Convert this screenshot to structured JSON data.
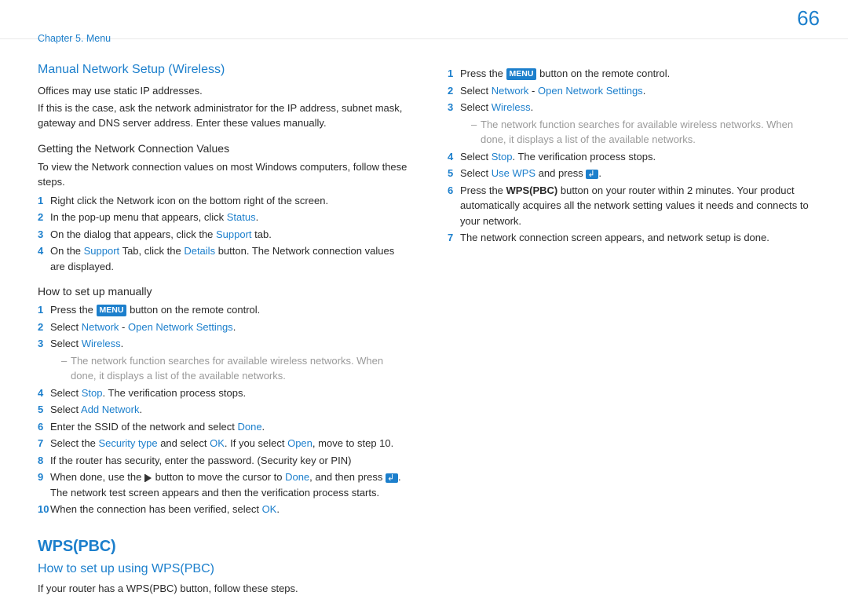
{
  "header": {
    "breadcrumb": "Chapter 5.  Menu",
    "page_number": "66"
  },
  "left": {
    "h_manual": "Manual Network Setup (Wireless)",
    "p_offices": "Offices may use static IP addresses.",
    "p_ifcase": "If this is the case, ask the network administrator for the IP address, subnet mask, gateway and DNS server address. Enter these values manually.",
    "h_getting": "Getting the Network Connection Values",
    "p_toview": "To view the Network connection values on most Windows computers, follow these steps.",
    "getting_steps": {
      "s1": "Right click the Network icon on the bottom right of the screen.",
      "s2_a": "In the pop-up menu that appears, click ",
      "s2_b": "Status",
      "s2_c": ".",
      "s3_a": "On the dialog that appears, click the ",
      "s3_b": "Support",
      "s3_c": " tab.",
      "s4_a": "On the ",
      "s4_b": "Support",
      "s4_c": " Tab, click the ",
      "s4_d": "Details",
      "s4_e": " button. The Network connection values are displayed."
    },
    "h_howto_manual": "How to set up manually",
    "manual_steps": {
      "s1_a": "Press the ",
      "s1_menu": "MENU",
      "s1_b": " button on the remote control.",
      "s2_a": "Select ",
      "s2_b": "Network",
      "s2_c": " - ",
      "s2_d": "Open Network Settings",
      "s2_e": ".",
      "s3_a": "Select ",
      "s3_b": "Wireless",
      "s3_c": ".",
      "s3_sub": "The network function searches for available wireless networks. When done, it displays a list of the available networks.",
      "s4_a": "Select ",
      "s4_b": "Stop",
      "s4_c": ". The verification process stops.",
      "s5_a": "Select ",
      "s5_b": "Add Network",
      "s5_c": ".",
      "s6_a": "Enter the SSID of the network and select ",
      "s6_b": "Done",
      "s6_c": ".",
      "s7_a": "Select the ",
      "s7_b": "Security type",
      "s7_c": " and select ",
      "s7_d": "OK",
      "s7_e": ". If you select ",
      "s7_f": "Open",
      "s7_g": ", move to step 10.",
      "s8": "If the router has security, enter the password. (Security key or PIN)",
      "s9_a": "When done, use the ",
      "s9_b": " button to move the cursor to ",
      "s9_c": "Done",
      "s9_d": ", and then press ",
      "s9_e": ". The network test screen appears and then the verification process starts.",
      "s10_a": "When the connection has been verified, select ",
      "s10_b": "OK",
      "s10_c": "."
    },
    "h_wps": "WPS(PBC)",
    "h_howto_wps": "How to set up using WPS(PBC)",
    "p_wps_intro": "If your router has a WPS(PBC) button, follow these steps."
  },
  "right": {
    "steps": {
      "s1_a": "Press the ",
      "s1_menu": "MENU",
      "s1_b": " button on the remote control.",
      "s2_a": "Select ",
      "s2_b": "Network",
      "s2_c": " - ",
      "s2_d": "Open Network Settings",
      "s2_e": ".",
      "s3_a": "Select ",
      "s3_b": "Wireless",
      "s3_c": ".",
      "s3_sub": "The network function searches for available wireless networks. When done, it displays a list of the available networks.",
      "s4_a": "Select ",
      "s4_b": "Stop",
      "s4_c": ". The verification process stops.",
      "s5_a": "Select ",
      "s5_b": "Use WPS",
      "s5_c": " and press ",
      "s5_d": ".",
      "s6_a": "Press the ",
      "s6_b": "WPS(PBC)",
      "s6_c": " button on your router within 2 minutes. Your product automatically acquires all the network setting values it needs and connects to your network.",
      "s7": "The network connection screen appears, and network setup is done."
    }
  }
}
